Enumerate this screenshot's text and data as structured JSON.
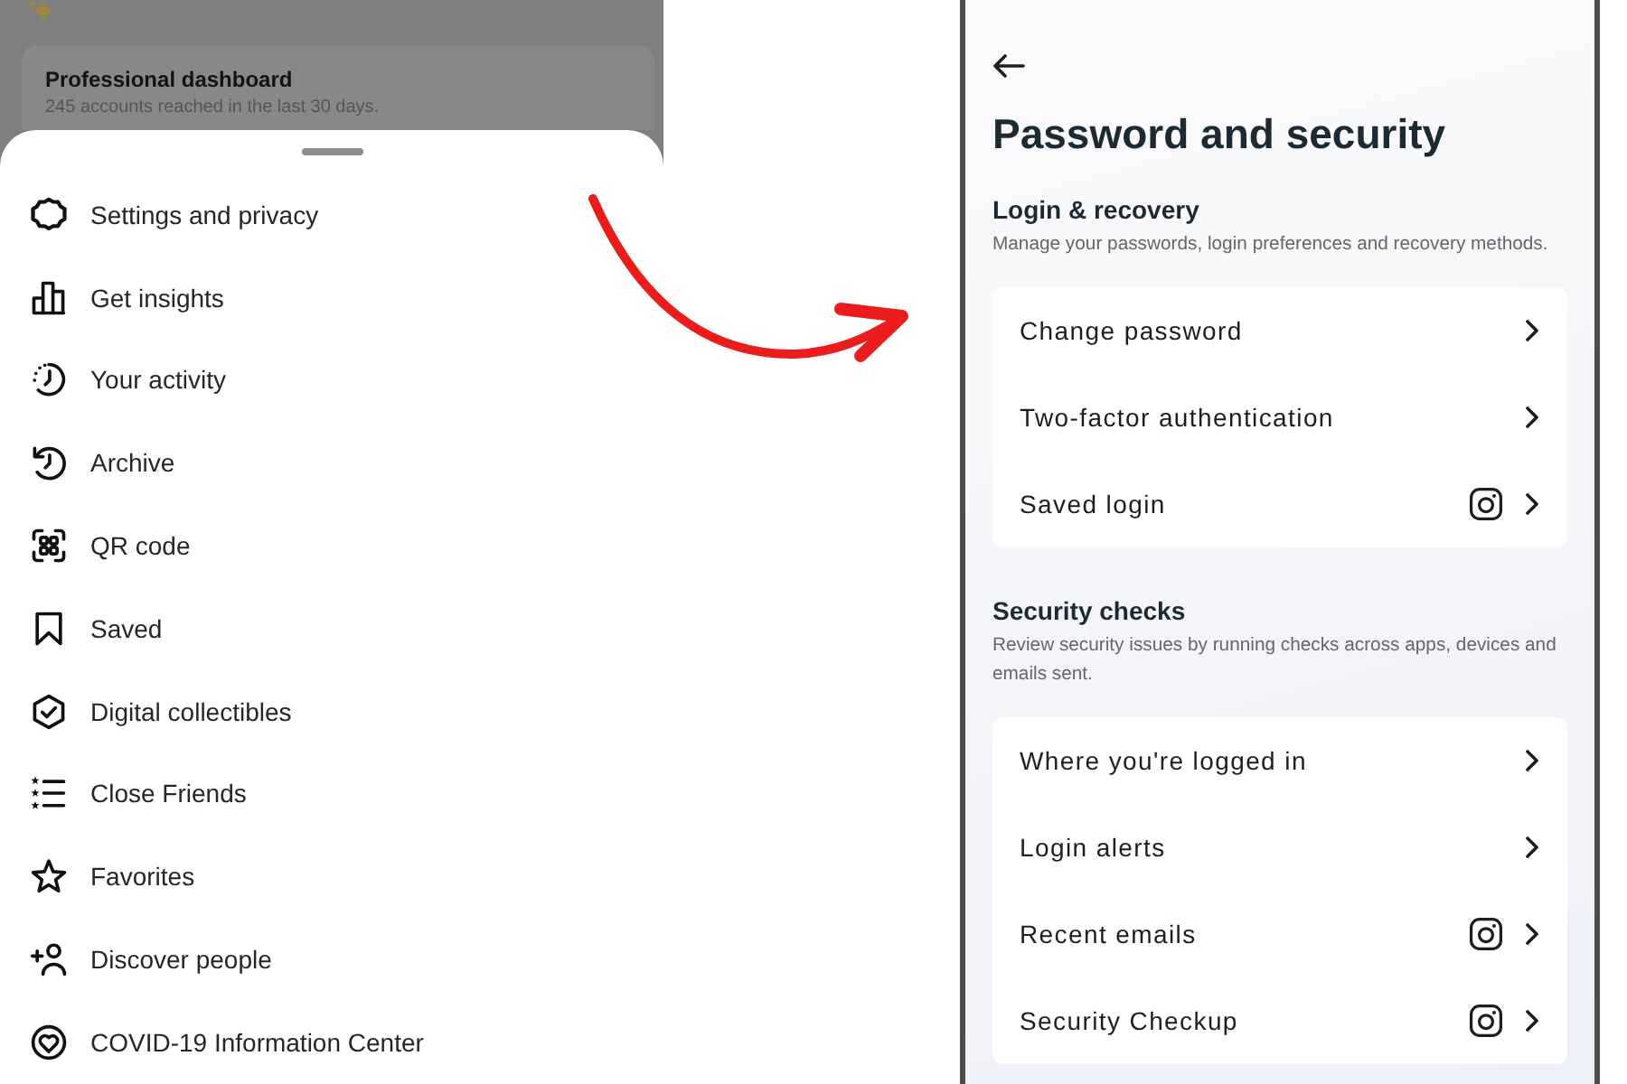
{
  "backdrop": {
    "dashboard_card": {
      "title": "Professional dashboard",
      "subtitle": "245 accounts reached in the last 30 days."
    }
  },
  "menu_sheet": {
    "items": [
      "Settings and privacy",
      "Get insights",
      "Your activity",
      "Archive",
      "QR code",
      "Saved",
      "Digital collectibles",
      "Close Friends",
      "Favorites",
      "Discover people",
      "COVID-19 Information Center"
    ]
  },
  "security_screen": {
    "title": "Password and security",
    "sections": [
      {
        "heading": "Login & recovery",
        "description": "Manage your passwords, login preferences and recovery methods.",
        "rows": [
          {
            "label": "Change password",
            "app_icon": false
          },
          {
            "label": "Two-factor authentication",
            "app_icon": false
          },
          {
            "label": "Saved login",
            "app_icon": true
          }
        ]
      },
      {
        "heading": "Security checks",
        "description": "Review security issues by running checks across apps, devices and emails sent.",
        "rows": [
          {
            "label": "Where you're logged in",
            "app_icon": false
          },
          {
            "label": "Login alerts",
            "app_icon": false
          },
          {
            "label": "Recent emails",
            "app_icon": true
          },
          {
            "label": "Security Checkup",
            "app_icon": true
          }
        ]
      }
    ]
  }
}
